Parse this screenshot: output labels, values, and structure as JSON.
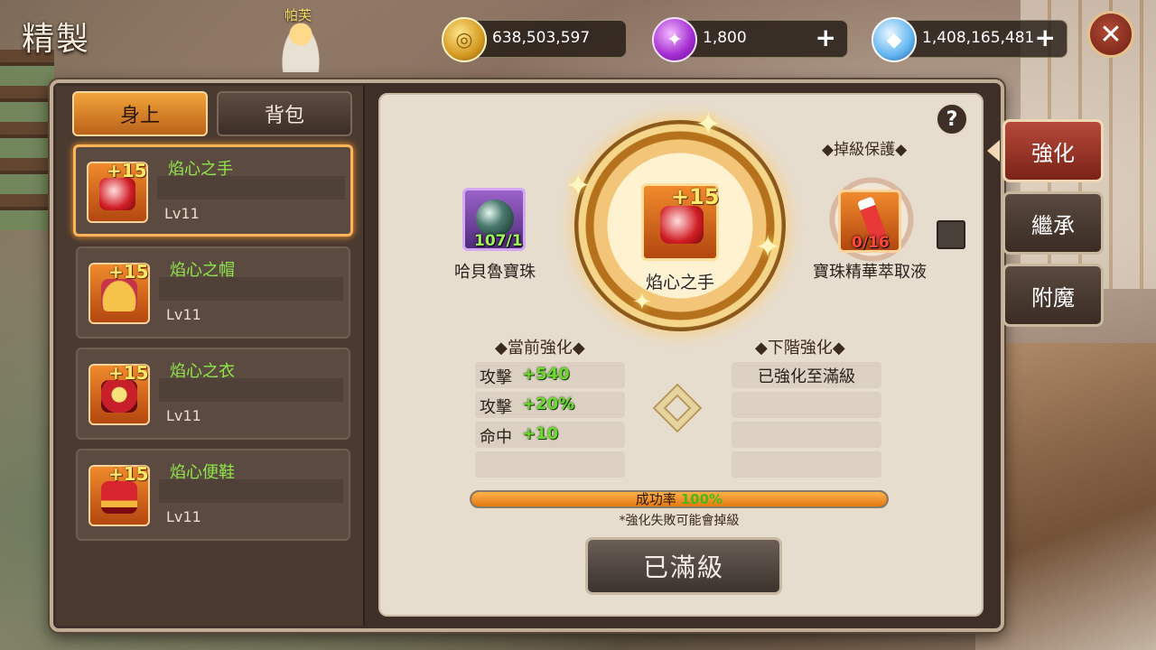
{
  "screen": {
    "title": "精製",
    "npc_name": "帕芙"
  },
  "currencies": [
    {
      "icon": "gold-coin-icon",
      "value": "638,503,597",
      "has_plus": false
    },
    {
      "icon": "purple-gem-icon",
      "value": "1,800",
      "has_plus": true,
      "plus": "+"
    },
    {
      "icon": "diamond-icon",
      "value": "1,408,165,481",
      "has_plus": true,
      "plus": "+"
    }
  ],
  "close_label": "✕",
  "tabs": {
    "equipped": "身上",
    "bag": "背包"
  },
  "items": [
    {
      "plus": "+15",
      "name": "焰心之手",
      "level": "Lv11",
      "selected": true
    },
    {
      "plus": "+15",
      "name": "焰心之帽",
      "level": "Lv11",
      "selected": false
    },
    {
      "plus": "+15",
      "name": "焰心之衣",
      "level": "Lv11",
      "selected": false
    },
    {
      "plus": "+15",
      "name": "焰心便鞋",
      "level": "Lv11",
      "selected": false
    }
  ],
  "enhance": {
    "help": "?",
    "material": {
      "name": "哈貝魯寶珠",
      "count": "107/1"
    },
    "center_item": {
      "plus": "+15",
      "name": "焰心之手"
    },
    "protection": {
      "title": "◆掉級保護◆",
      "name": "寶珠精華萃取液",
      "count": "0/16"
    },
    "current_title": "◆當前強化◆",
    "next_title": "◆下階強化◆",
    "current_stats": [
      {
        "label": "攻擊",
        "value": "+540"
      },
      {
        "label": "攻擊",
        "value": "+20%"
      },
      {
        "label": "命中",
        "value": "+10"
      }
    ],
    "next_text": "已強化至滿級",
    "success_label": "成功率",
    "success_rate": "100%",
    "success_fraction": 1.0,
    "fail_note": "*強化失敗可能會掉級",
    "button": "已滿級"
  },
  "side_tabs": [
    "強化",
    "繼承",
    "附魔"
  ],
  "colors": {
    "accent": "#f3a43a",
    "stat_green": "#6fd832",
    "panel_bg": "#e7ddcf"
  }
}
